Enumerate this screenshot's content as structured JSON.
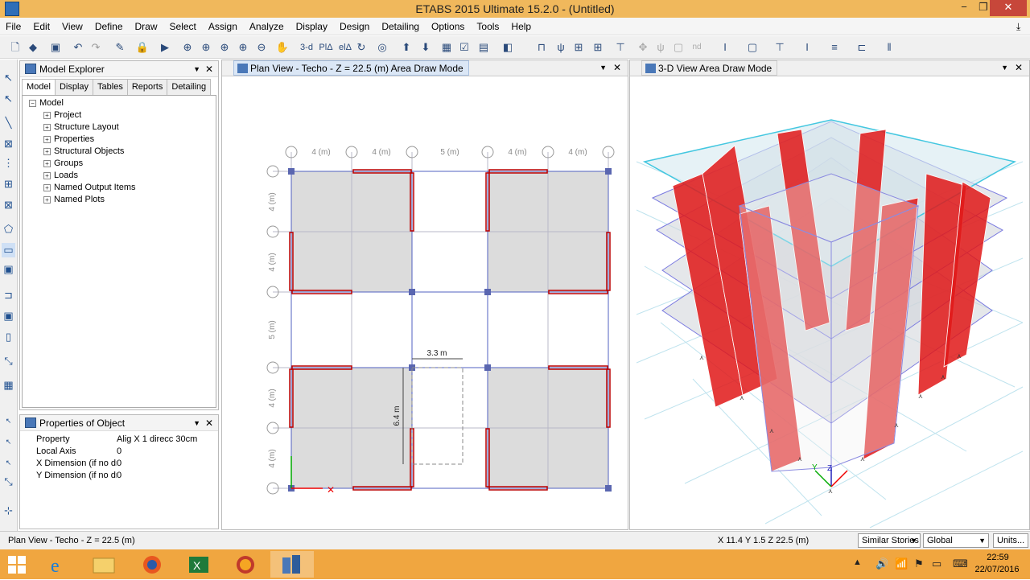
{
  "titlebar": {
    "title": "ETABS 2015 Ultimate 15.2.0 - (Untitled)",
    "minimize": "−",
    "maximize": "❐",
    "close": "✕"
  },
  "menu": [
    "File",
    "Edit",
    "View",
    "Define",
    "Draw",
    "Select",
    "Assign",
    "Analyze",
    "Display",
    "Design",
    "Detailing",
    "Options",
    "Tools",
    "Help"
  ],
  "toolbar": {
    "view3d": "3-d",
    "plan": "PlΔ",
    "elev": "elΔ",
    "nd": "nd"
  },
  "explorer": {
    "title": "Model Explorer",
    "tabs": [
      "Model",
      "Display",
      "Tables",
      "Reports",
      "Detailing"
    ],
    "active_tab": "Model",
    "root": "Model",
    "items": [
      "Project",
      "Structure Layout",
      "Properties",
      "Structural Objects",
      "Groups",
      "Loads",
      "Named Output Items",
      "Named Plots"
    ]
  },
  "properties": {
    "title": "Properties of Object",
    "rows": [
      {
        "key": "Property",
        "value": "Alig X 1 direcc 30cm"
      },
      {
        "key": "Local Axis",
        "value": "0"
      },
      {
        "key": "X Dimension (if no dra",
        "value": "0"
      },
      {
        "key": "Y Dimension (if no dra",
        "value": "0"
      }
    ]
  },
  "plan": {
    "title": "Plan View - Techo - Z = 22.5 (m)  Area Draw Mode",
    "top_dims": [
      "4 (m)",
      "4 (m)",
      "5 (m)",
      "4 (m)",
      "4 (m)"
    ],
    "left_dims": [
      "4 (m)",
      "4 (m)",
      "5 (m)",
      "4 (m)",
      "4 (m)"
    ],
    "dim_width": "3.3 m",
    "dim_height": "6.4 m"
  },
  "view3d": {
    "title": "3-D View  Area Draw Mode",
    "axis_z": "Z",
    "axis_y": "Y"
  },
  "status": {
    "left": "Plan View - Techo - Z = 22.5 (m)",
    "coords": "X 11.4  Y 1.5  Z 22.5 (m)",
    "stories": "Similar Stories",
    "coord_sys": "Global",
    "units": "Units..."
  },
  "taskbar": {
    "time": "22:59",
    "date": "22/07/2016"
  },
  "colors": {
    "title": "#f0b85c",
    "taskbar": "#f0a640",
    "wall": "#d81818",
    "slab": "#c8c8c8"
  }
}
